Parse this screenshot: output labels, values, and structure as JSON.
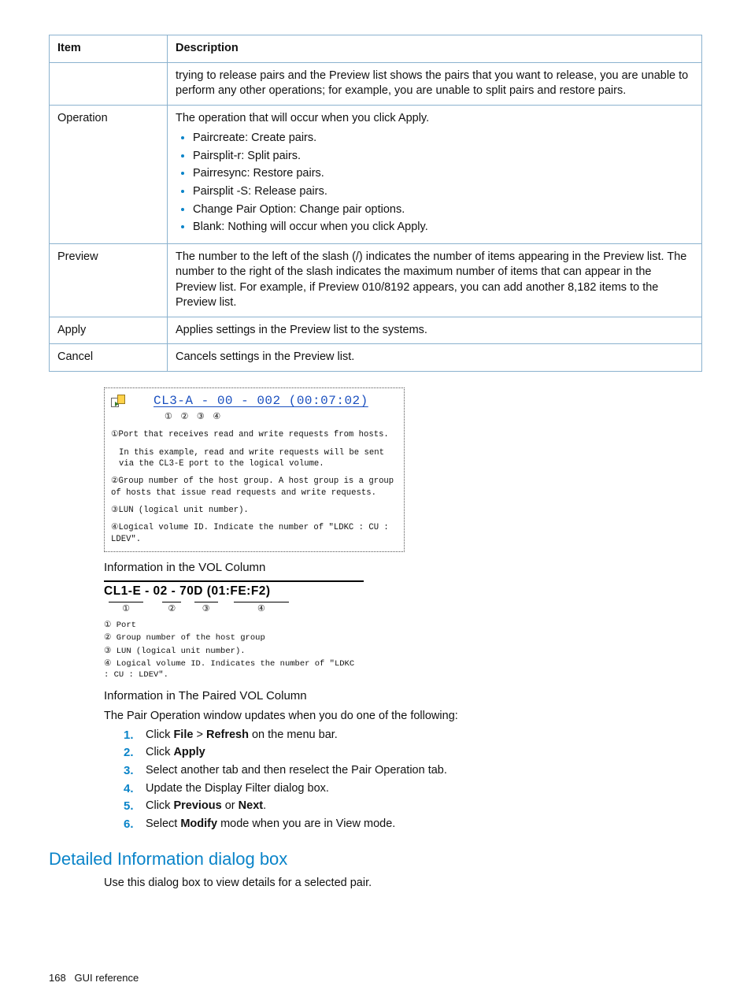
{
  "table": {
    "head": {
      "item": "Item",
      "desc": "Description"
    },
    "rows": {
      "r0": {
        "item": "",
        "desc": "trying to release pairs and the Preview list shows the pairs that you want to release, you are unable to perform any other operations; for example, you are unable to split pairs and restore pairs."
      },
      "r1": {
        "item": "Operation",
        "desc_intro": "The operation that will occur when you click Apply.",
        "bullets": {
          "b0": "Paircreate: Create pairs.",
          "b1": "Pairsplit-r: Split pairs.",
          "b2": "Pairresync: Restore pairs.",
          "b3": "Pairsplit -S: Release pairs.",
          "b4": "Change Pair Option: Change pair options.",
          "b5": "Blank: Nothing will occur when you click Apply."
        }
      },
      "r2": {
        "item": "Preview",
        "desc": "The number to the left of the slash (/) indicates the number of items appearing in the Preview list. The number to the right of the slash indicates the maximum number of items that can appear in the Preview list. For example, if Preview 010/8192 appears, you can add another 8,182 items to the Preview list."
      },
      "r3": {
        "item": "Apply",
        "desc": "Applies settings in the Preview list to the systems."
      },
      "r4": {
        "item": "Cancel",
        "desc": "Cancels settings in the Preview list."
      }
    }
  },
  "diagram1": {
    "header": "CL3-A - 00 - 002 (00:07:02)",
    "circles": "①       ②       ③             ④",
    "n1a": "①Port that receives read and write requests from hosts.",
    "n1b": "In this example, read and write requests will be sent via the CL3-E port to the logical volume.",
    "n2": "②Group number of the host group. A host group is a group of hosts that issue read requests and write requests.",
    "n3": "③LUN (logical unit number).",
    "n4": "④Logical volume ID. Indicate the number of \"LDKC : CU : LDEV\"."
  },
  "caption1": "Information in the VOL Column",
  "diagram2": {
    "header": "CL1-E - 02 - 70D (01:FE:F2)",
    "circles": {
      "c1": "①",
      "c2": "②",
      "c3": "③",
      "c4": "④"
    },
    "l1": "① Port",
    "l2": "② Group number of the host group",
    "l3": "③ LUN (logical unit number).",
    "l4": "④ Logical volume ID. Indicates the number of \"LDKC : CU : LDEV\"."
  },
  "caption2": "Information in The Paired VOL Column",
  "para1": "The Pair Operation window updates when you do one of the following:",
  "steps": {
    "s1": {
      "pre": "Click ",
      "b1": "File",
      "mid": " > ",
      "b2": "Refresh",
      "post": " on the menu bar."
    },
    "s2": {
      "pre": "Click ",
      "b1": "Apply"
    },
    "s3": {
      "text": "Select another tab and then reselect the Pair Operation tab."
    },
    "s4": {
      "text": "Update the Display Filter dialog box."
    },
    "s5": {
      "pre": "Click ",
      "b1": "Previous",
      "mid": " or ",
      "b2": "Next",
      "post": "."
    },
    "s6": {
      "pre": "Select ",
      "b1": "Modify",
      "post": " mode when you are in View mode."
    }
  },
  "section_title": "Detailed Information dialog box",
  "section_para": "Use this dialog box to view details for a selected pair.",
  "footer": {
    "page": "168",
    "label": "GUI reference"
  }
}
